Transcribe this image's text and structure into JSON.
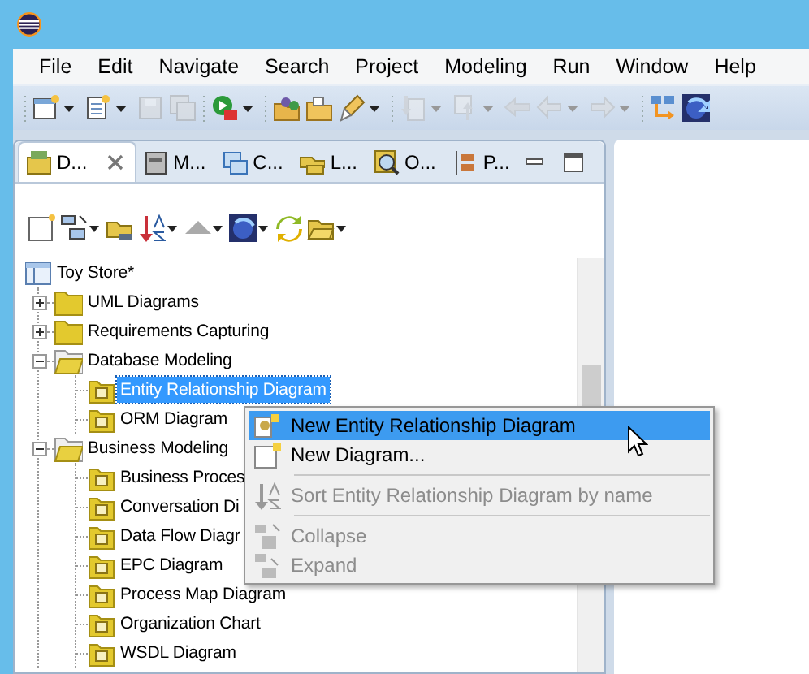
{
  "menu_bar": [
    "File",
    "Edit",
    "Navigate",
    "Search",
    "Project",
    "Modeling",
    "Run",
    "Window",
    "Help"
  ],
  "toolbar": [
    {
      "kind": "new-doc",
      "dropdown": true,
      "disabled": false
    },
    {
      "kind": "new-list",
      "dropdown": true,
      "disabled": false
    },
    {
      "kind": "save",
      "dropdown": false,
      "disabled": true
    },
    {
      "kind": "save-all",
      "dropdown": false,
      "disabled": true
    },
    {
      "kind": "run",
      "dropdown": true,
      "disabled": false
    },
    {
      "kind": "open-project",
      "dropdown": false,
      "disabled": false
    },
    {
      "kind": "folder",
      "dropdown": false,
      "disabled": false
    },
    {
      "kind": "brush",
      "dropdown": true,
      "disabled": false
    },
    {
      "kind": "doc-down",
      "dropdown": true,
      "disabled": true
    },
    {
      "kind": "doc-up",
      "dropdown": true,
      "disabled": true
    },
    {
      "kind": "back",
      "dropdown": false,
      "disabled": true
    },
    {
      "kind": "left",
      "dropdown": true,
      "disabled": true
    },
    {
      "kind": "right",
      "dropdown": true,
      "disabled": true
    },
    {
      "kind": "hierarchy",
      "dropdown": false,
      "disabled": false
    },
    {
      "kind": "globe",
      "dropdown": false,
      "disabled": false
    }
  ],
  "tabs": [
    {
      "label": "D...",
      "selected": true
    },
    {
      "label": "M...",
      "selected": false
    },
    {
      "label": "C...",
      "selected": false
    },
    {
      "label": "L...",
      "selected": false
    },
    {
      "label": "O...",
      "selected": false
    },
    {
      "label": "P...",
      "selected": false
    }
  ],
  "tree": {
    "label": "Toy Store*",
    "kind": "project",
    "children": [
      {
        "label": "UML Diagrams",
        "kind": "folder",
        "expanded": false,
        "selected": false
      },
      {
        "label": "Requirements Capturing",
        "kind": "folder",
        "expanded": false,
        "selected": false
      },
      {
        "label": "Database Modeling",
        "kind": "folder",
        "expanded": true,
        "selected": false,
        "children": [
          {
            "label": "Entity Relationship Diagram",
            "kind": "diagram",
            "selected": true
          },
          {
            "label": "ORM Diagram",
            "kind": "diagram",
            "selected": false
          }
        ]
      },
      {
        "label": "Business Modeling",
        "kind": "folder",
        "expanded": true,
        "selected": false,
        "children": [
          {
            "label": "Business Proces",
            "kind": "diagram",
            "selected": false
          },
          {
            "label": "Conversation Di",
            "kind": "diagram",
            "selected": false
          },
          {
            "label": "Data Flow Diagr",
            "kind": "diagram",
            "selected": false
          },
          {
            "label": "EPC Diagram",
            "kind": "diagram",
            "selected": false
          },
          {
            "label": "Process Map Diagram",
            "kind": "diagram",
            "selected": false
          },
          {
            "label": "Organization Chart",
            "kind": "diagram",
            "selected": false
          },
          {
            "label": "WSDL Diagram",
            "kind": "diagram",
            "selected": false
          }
        ]
      }
    ]
  },
  "context_menu": [
    {
      "kind": "item",
      "label": "New Entity Relationship Diagram",
      "selected": true,
      "disabled": false
    },
    {
      "kind": "item",
      "label": "New Diagram...",
      "selected": false,
      "disabled": false
    },
    {
      "kind": "separator"
    },
    {
      "kind": "item",
      "label": "Sort Entity Relationship Diagram by name",
      "selected": false,
      "disabled": true
    },
    {
      "kind": "separator"
    },
    {
      "kind": "item",
      "label": "Collapse",
      "selected": false,
      "disabled": true
    },
    {
      "kind": "item",
      "label": "Expand",
      "selected": false,
      "disabled": true
    }
  ]
}
